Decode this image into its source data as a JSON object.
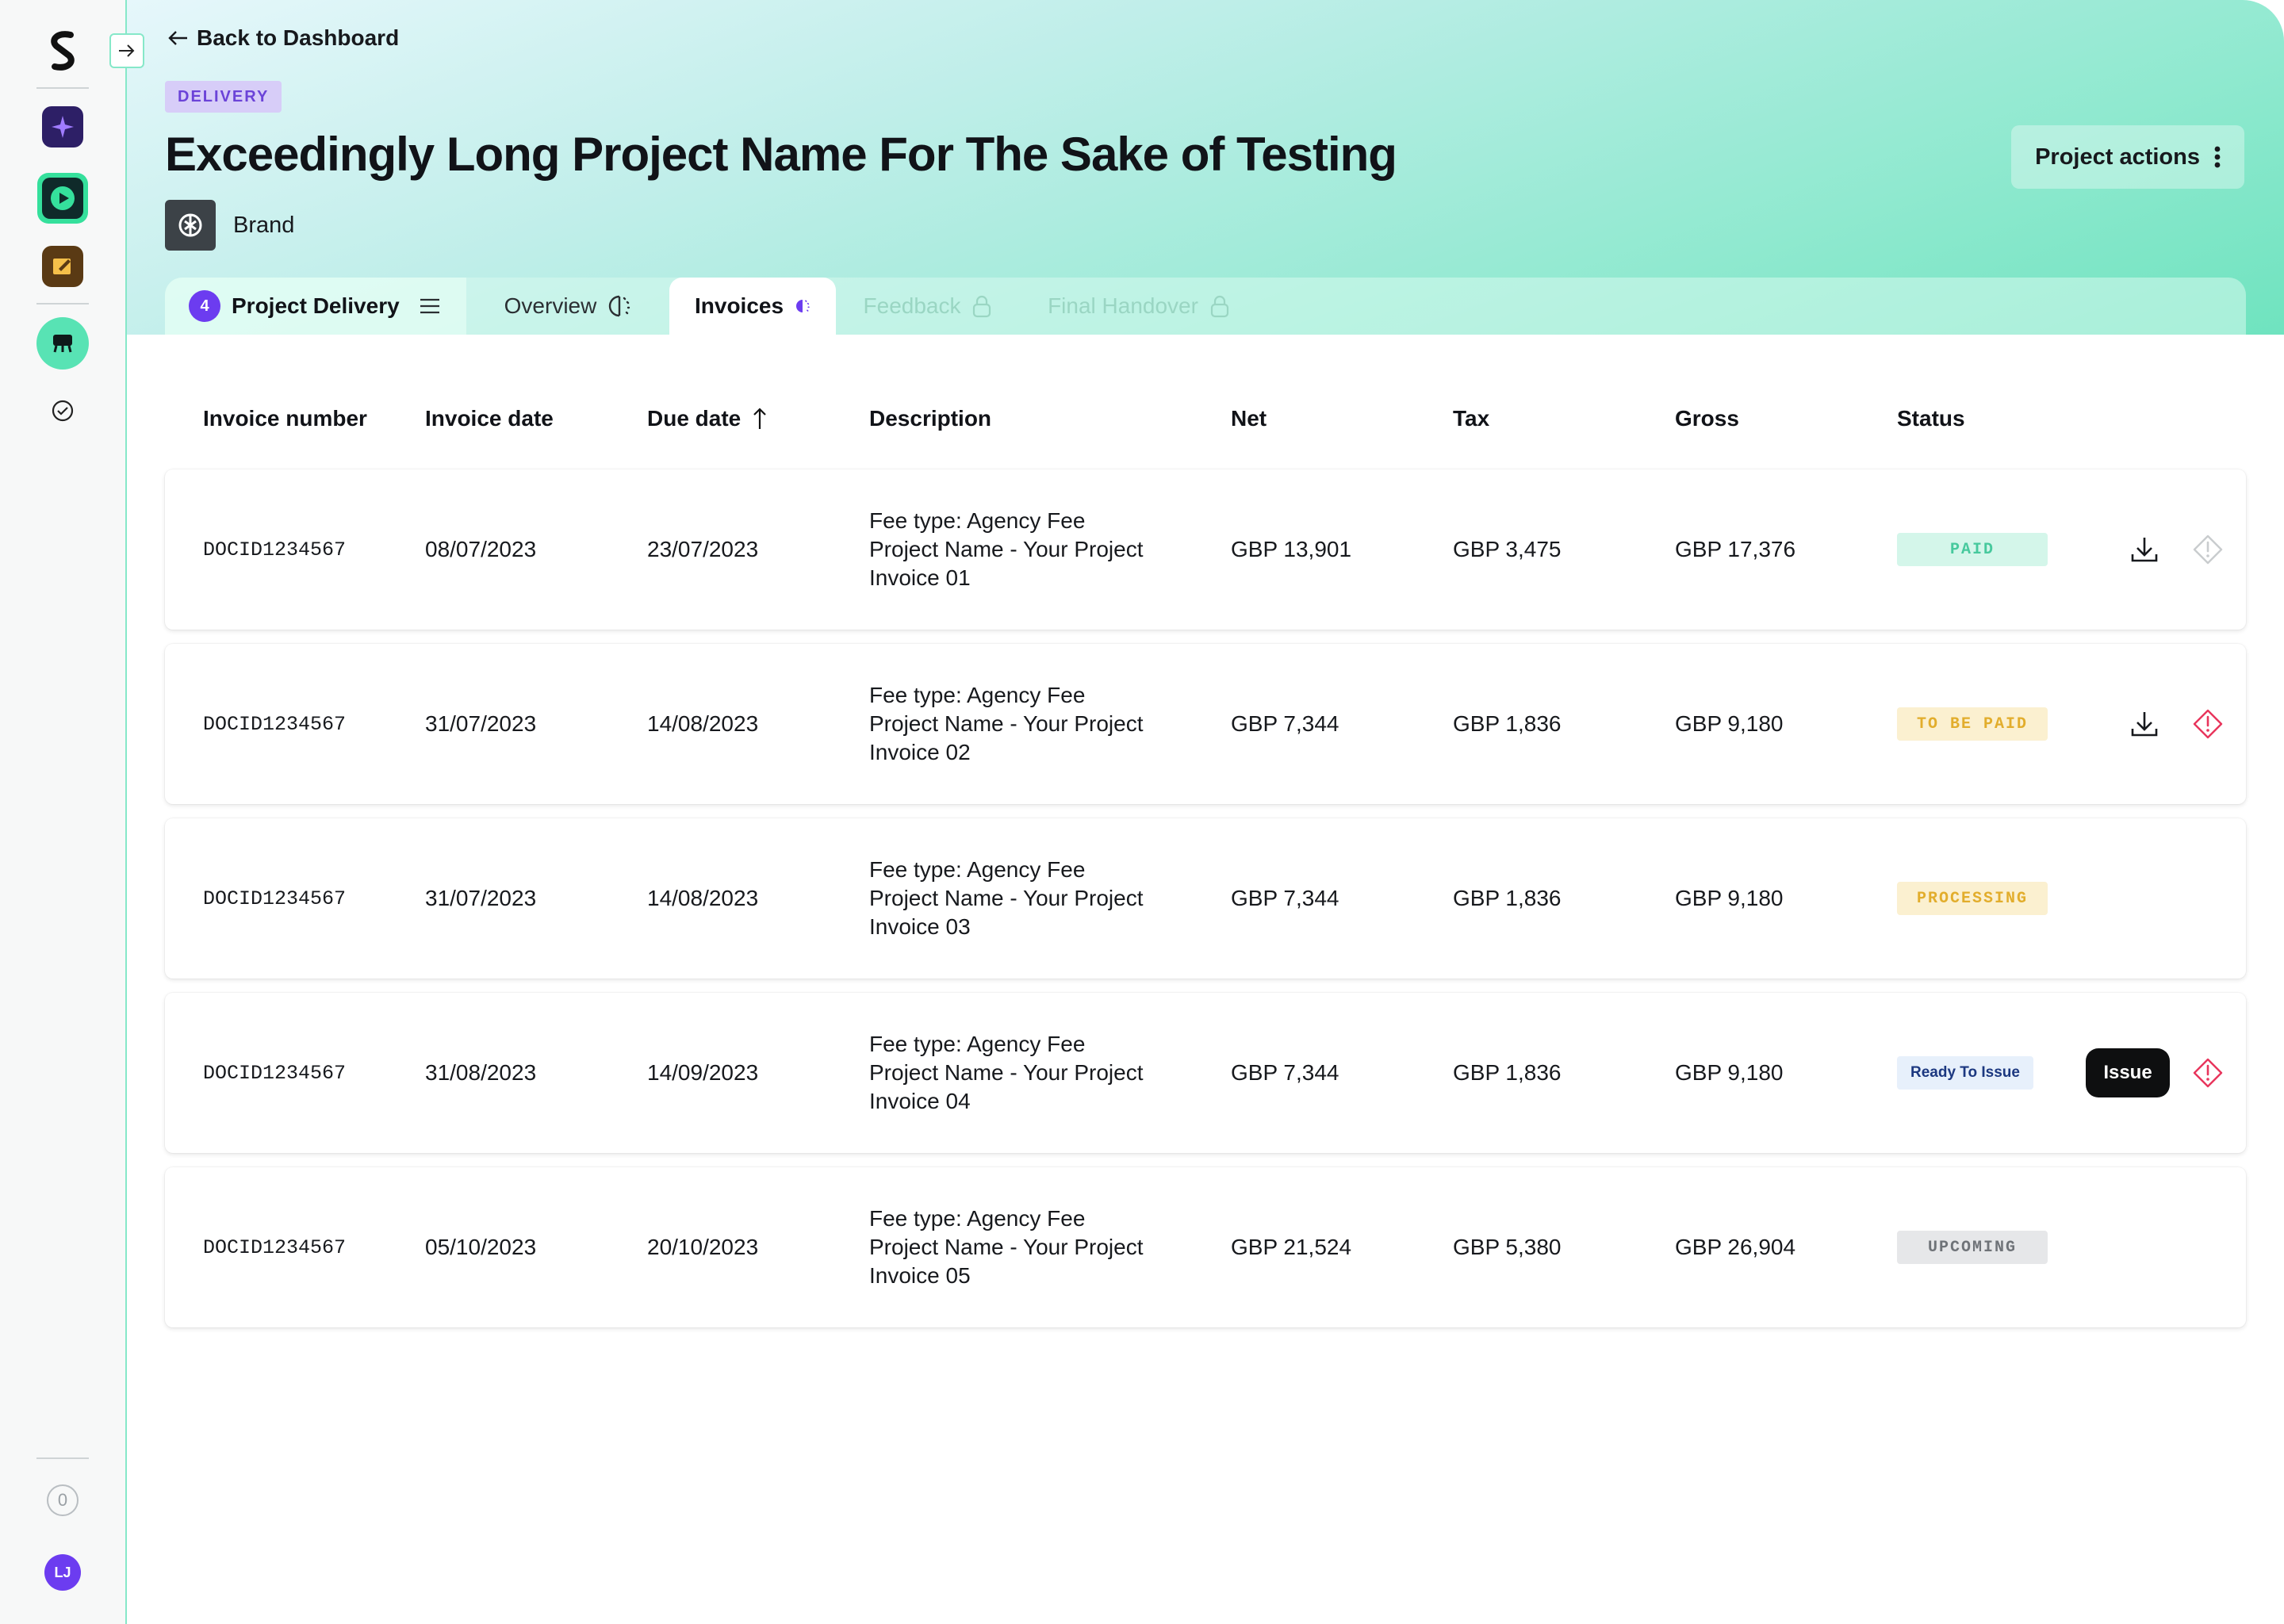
{
  "header": {
    "back_label": "Back to Dashboard",
    "category_badge": "DELIVERY",
    "project_title": "Exceedingly Long Project Name For The Sake of Testing",
    "brand_name": "Brand",
    "project_actions_label": "Project actions"
  },
  "sidebar": {
    "count": "0",
    "avatar_initials": "LJ"
  },
  "tabs": {
    "delivery": {
      "count": "4",
      "label": "Project Delivery"
    },
    "overview": {
      "label": "Overview"
    },
    "invoices": {
      "label": "Invoices"
    },
    "feedback": {
      "label": "Feedback"
    },
    "handover": {
      "label": "Final Handover"
    }
  },
  "table": {
    "columns": [
      "Invoice number",
      "Invoice date",
      "Due date",
      "Description",
      "Net",
      "Tax",
      "Gross",
      "Status"
    ],
    "rows": [
      {
        "number": "DOCID1234567",
        "date": "08/07/2023",
        "due": "23/07/2023",
        "desc": [
          "Fee type: Agency Fee",
          "Project Name - Your Project",
          "Invoice 01"
        ],
        "net": "GBP 13,901",
        "tax": "GBP 3,475",
        "gross": "GBP 17,376",
        "status": "PAID"
      },
      {
        "number": "DOCID1234567",
        "date": "31/07/2023",
        "due": "14/08/2023",
        "desc": [
          "Fee type: Agency Fee",
          "Project Name - Your Project",
          "Invoice 02"
        ],
        "net": "GBP 7,344",
        "tax": "GBP 1,836",
        "gross": "GBP 9,180",
        "status": "TO BE PAID"
      },
      {
        "number": "DOCID1234567",
        "date": "31/07/2023",
        "due": "14/08/2023",
        "desc": [
          "Fee type: Agency Fee",
          "Project Name - Your Project",
          "Invoice 03"
        ],
        "net": "GBP 7,344",
        "tax": "GBP 1,836",
        "gross": "GBP 9,180",
        "status": "PROCESSING"
      },
      {
        "number": "DOCID1234567",
        "date": "31/08/2023",
        "due": "14/09/2023",
        "desc": [
          "Fee type: Agency Fee",
          "Project Name - Your Project",
          "Invoice 04"
        ],
        "net": "GBP 7,344",
        "tax": "GBP 1,836",
        "gross": "GBP 9,180",
        "status": "Ready To Issue",
        "issue_label": "Issue"
      },
      {
        "number": "DOCID1234567",
        "date": "05/10/2023",
        "due": "20/10/2023",
        "desc": [
          "Fee type: Agency Fee",
          "Project Name - Your Project",
          "Invoice 05"
        ],
        "net": "GBP 21,524",
        "tax": "GBP 5,380",
        "gross": "GBP 26,904",
        "status": "UPCOMING"
      }
    ]
  },
  "colors": {
    "accent_purple": "#6c3cf0",
    "accent_green": "#58e3b4",
    "alert_red": "#e8355c",
    "paid": "#47c99d",
    "pending": "#e2ad2c"
  }
}
